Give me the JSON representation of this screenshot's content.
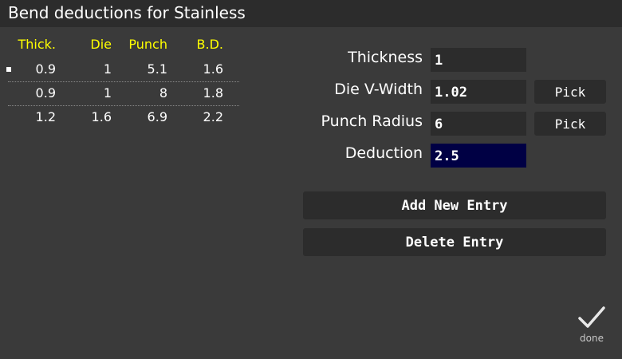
{
  "title": "Bend deductions for Stainless",
  "table": {
    "headers": [
      "Thick.",
      "Die",
      "Punch",
      "B.D."
    ],
    "rows": [
      [
        "0.9",
        "1",
        "5.1",
        "1.6"
      ],
      [
        "0.9",
        "1",
        "8",
        "1.8"
      ],
      [
        "1.2",
        "1.6",
        "6.9",
        "2.2"
      ]
    ],
    "selected_row": 0
  },
  "form": {
    "thickness_label": "Thickness",
    "thickness_value": "1",
    "die_label": "Die V-Width",
    "die_value": "1.02",
    "punch_label": "Punch Radius",
    "punch_value": "6",
    "deduction_label": "Deduction",
    "deduction_value": "2.5",
    "pick_label": "Pick"
  },
  "buttons": {
    "add": "Add New Entry",
    "delete": "Delete Entry",
    "done": "done"
  },
  "colors": {
    "background": "#3a3a3a",
    "panel": "#2c2c2c",
    "header_text": "#ffff00",
    "active_field": "#000044"
  },
  "icons": {
    "done": "checkmark-icon"
  }
}
